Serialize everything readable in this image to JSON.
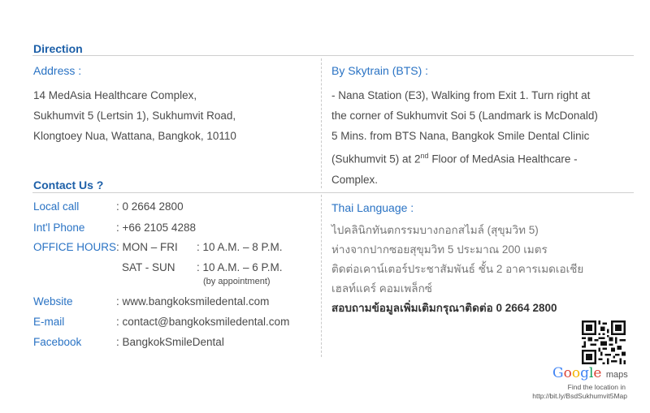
{
  "direction": {
    "heading": "Direction",
    "address_label": "Address :",
    "address_lines": [
      "14 MedAsia Healthcare Complex,",
      "Sukhumvit 5 (Lertsin 1),  Sukhumvit Road,",
      "Klongtoey Nua,  Wattana,  Bangkok, 10110"
    ],
    "bts_label": "By Skytrain (BTS) :",
    "bts_lines": [
      "- Nana Station (E3), Walking from Exit 1. Turn right at",
      "the corner of Sukhumvit Soi 5 (Landmark is McDonald)",
      "5 Mins. from BTS Nana, Bangkok Smile Dental Clinic",
      "(Sukhumvit 5) at 2",
      "nd",
      " Floor of MedAsia Healthcare -",
      "Complex."
    ]
  },
  "contact": {
    "heading": "Contact Us ?",
    "local_call_label": "Local call",
    "local_call_value": ": 0 2664 2800",
    "intl_label": "Int'l Phone",
    "intl_value": ": +66 2105 4288",
    "hours_label": "OFFICE HOURS",
    "hours_weekday_days": ": MON – FRI",
    "hours_weekday_time": ": 10 A.M. – 8 P.M.",
    "hours_weekend_days": "SAT - SUN",
    "hours_weekend_time": ": 10 A.M. – 6 P.M.",
    "hours_weekend_note": "(by appointment)",
    "website_label": "Website",
    "website_value": ": www.bangkoksmiledental.com",
    "email_label": "E-mail",
    "email_value": ": contact@bangkoksmiledental.com",
    "facebook_label": "Facebook",
    "facebook_value": ": BangkokSmileDental"
  },
  "thai": {
    "label": "Thai Language :",
    "lines": [
      "ไปคลินิกทันตกรรมบางกอกสไมล์ (สุขุมวิท 5)",
      "ห่างจากปากซอยสุขุมวิท 5 ประมาณ 200 เมตร",
      "ติดต่อเคาน์เตอร์ประชาสัมพันธ์ ชั้น 2 อาคารเมดเอเชีย",
      "เฮลท์แคร์ คอมเพล็กซ์"
    ],
    "bold_line": "สอบถามข้อมูลเพิ่มเติมกรุณาติดต่อ 0 2664 2800"
  },
  "map": {
    "logo_text": "Google",
    "maps_text": "maps",
    "find_text": "Find the location in",
    "url": "http://bit.ly/BsdSukhumvit5Map",
    "qr_icon": "qr-code-icon",
    "colors": {
      "g_blue": "#4285f4",
      "g_red": "#db4437",
      "g_yellow": "#f4b400",
      "g_green": "#0f9d58"
    }
  }
}
